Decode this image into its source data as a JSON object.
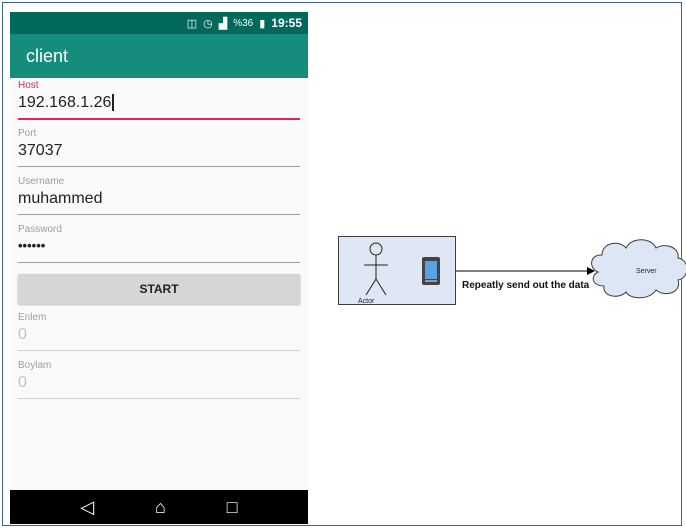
{
  "status_bar": {
    "signal_text": "%36",
    "time": "19:55"
  },
  "app": {
    "title": "client"
  },
  "form": {
    "host": {
      "label": "Host",
      "value": "192.168.1.26"
    },
    "port": {
      "label": "Port",
      "value": "37037"
    },
    "username": {
      "label": "Username",
      "value": "muhammed"
    },
    "password": {
      "label": "Password",
      "value": "••••••"
    },
    "start_label": "START",
    "enlem": {
      "label": "Enlem",
      "value": "0"
    },
    "boylam": {
      "label": "Boylam",
      "value": "0"
    }
  },
  "nav": {
    "back_icon": "back-triangle-icon",
    "home_icon": "home-icon",
    "recents_icon": "recents-square-icon"
  },
  "diagram": {
    "actor_label": "Actor",
    "arrow_label": "Repeatly send out the data",
    "server_label": "Server"
  },
  "colors": {
    "primary": "#168c7c",
    "primary_dark": "#00695c",
    "accent": "#e91e63"
  }
}
